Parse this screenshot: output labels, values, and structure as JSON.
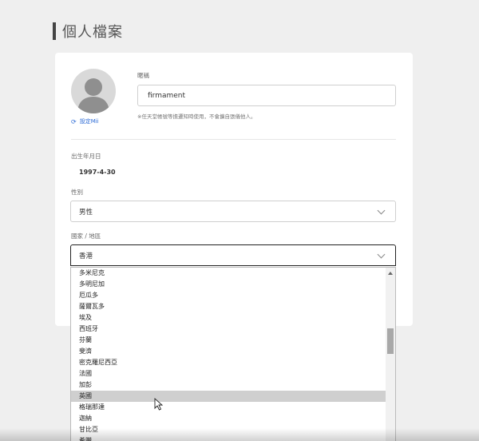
{
  "page": {
    "title": "個人檔案"
  },
  "profile": {
    "set_mii_label": "設定Mii",
    "nickname_label": "暱稱",
    "nickname_value": "firmament",
    "nickname_hint": "※任天堂帳號等擔遷知時使用，不會擴自張儀他人。",
    "dob_label": "出生年月日",
    "dob_value": "1997-4-30",
    "gender_label": "性別",
    "gender_value": "男性",
    "region_label": "國家 / 地區",
    "region_value": "香港"
  },
  "dropdown": {
    "options": [
      "多米尼克",
      "多明尼加",
      "厄瓜多",
      "薩爾瓦多",
      "埃及",
      "西班牙",
      "芬蘭",
      "斐濟",
      "密克羅尼西亞",
      "法國",
      "加彭",
      "英國",
      "格瑞那達",
      "迦納",
      "甘比亞",
      "希臘"
    ],
    "hovered_option": "英國"
  },
  "icons": {
    "avatar": "person-silhouette-icon",
    "refresh": "refresh-icon",
    "chevron": "chevron-down-icon",
    "cursor": "mouse-pointer-icon"
  },
  "colors": {
    "link": "#2d6bd6",
    "background": "#efefef",
    "hover": "#cfcfcf"
  }
}
